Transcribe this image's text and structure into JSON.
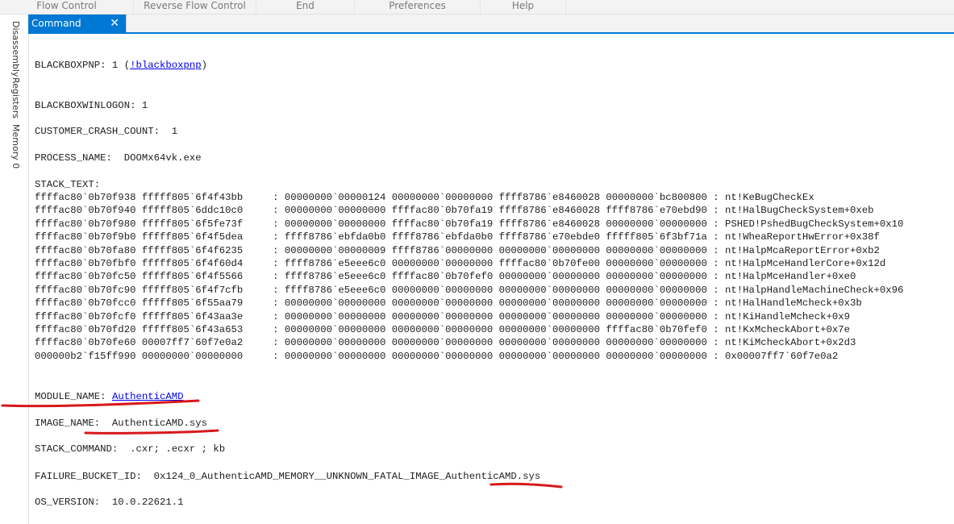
{
  "ribbon": {
    "items": [
      "Flow Control",
      "Reverse Flow Control",
      "End",
      "Preferences",
      "Help"
    ]
  },
  "tab": {
    "label": "Command",
    "close": "✕"
  },
  "sidebar": {
    "items": [
      "Disassembly",
      "Registers",
      "Memory 0"
    ]
  },
  "output": {
    "blackboxpnp": {
      "key": "BLACKBOXPNP: 1 (",
      "link": "!blackboxpnp",
      "tail": ")"
    },
    "blackboxwinlogon": "BLACKBOXWINLOGON: 1",
    "customer_crash_count": "CUSTOMER_CRASH_COUNT:  1",
    "process_name": "PROCESS_NAME:  DOOMx64vk.exe",
    "stack_text_label": "STACK_TEXT:",
    "stack_text": [
      "ffffac80`0b70f938 fffff805`6f4f43bb     : 00000000`00000124 00000000`00000000 ffff8786`e8460028 00000000`bc800800 : nt!KeBugCheckEx",
      "ffffac80`0b70f940 fffff805`6ddc10c0     : 00000000`00000000 ffffac80`0b70fa19 ffff8786`e8460028 ffff8786`e70ebd90 : nt!HalBugCheckSystem+0xeb",
      "ffffac80`0b70f980 fffff805`6f5fe73f     : 00000000`00000000 ffffac80`0b70fa19 ffff8786`e8460028 00000000`00000000 : PSHED!PshedBugCheckSystem+0x10",
      "ffffac80`0b70f9b0 fffff805`6f4f5dea     : ffff8786`ebfda0b0 ffff8786`ebfda0b0 ffff8786`e70ebde0 fffff805`6f3bf71a : nt!WheaReportHwError+0x38f",
      "ffffac80`0b70fa80 fffff805`6f4f6235     : 00000000`00000009 ffff8786`00000000 00000000`00000000 00000000`00000000 : nt!HalpMcaReportError+0xb2",
      "ffffac80`0b70fbf0 fffff805`6f4f60d4     : ffff8786`e5eee6c0 00000000`00000000 ffffac80`0b70fe00 00000000`00000000 : nt!HalpMceHandlerCore+0x12d",
      "ffffac80`0b70fc50 fffff805`6f4f5566     : ffff8786`e5eee6c0 ffffac80`0b70fef0 00000000`00000000 00000000`00000000 : nt!HalpMceHandler+0xe0",
      "ffffac80`0b70fc90 fffff805`6f4f7cfb     : ffff8786`e5eee6c0 00000000`00000000 00000000`00000000 00000000`00000000 : nt!HalpHandleMachineCheck+0x96",
      "ffffac80`0b70fcc0 fffff805`6f55aa79     : 00000000`00000000 00000000`00000000 00000000`00000000 00000000`00000000 : nt!HalHandleMcheck+0x3b",
      "ffffac80`0b70fcf0 fffff805`6f43aa3e     : 00000000`00000000 00000000`00000000 00000000`00000000 00000000`00000000 : nt!KiHandleMcheck+0x9",
      "ffffac80`0b70fd20 fffff805`6f43a653     : 00000000`00000000 00000000`00000000 00000000`00000000 ffffac80`0b70fef0 : nt!KxMcheckAbort+0x7e",
      "ffffac80`0b70fe60 00007ff7`60f7e0a2     : 00000000`00000000 00000000`00000000 00000000`00000000 00000000`00000000 : nt!KiMcheckAbort+0x2d3",
      "000000b2`f15ff990 00000000`00000000     : 00000000`00000000 00000000`00000000 00000000`00000000 00000000`00000000 : 0x00007ff7`60f7e0a2"
    ],
    "module_name": {
      "key": "MODULE_NAME: ",
      "link": "AuthenticAMD"
    },
    "image_name": "IMAGE_NAME:  AuthenticAMD.sys",
    "stack_command": "STACK_COMMAND:  .cxr; .ecxr ; kb",
    "failure_bucket_id": "FAILURE_BUCKET_ID:  0x124_0_AuthenticAMD_MEMORY__UNKNOWN_FATAL_IMAGE_AuthenticAMD.sys",
    "os_version": "OS_VERSION:  10.0.22621.1"
  },
  "colors": {
    "accent": "#0078d4",
    "link": "#0000ee",
    "annotation": "#d7191c"
  }
}
